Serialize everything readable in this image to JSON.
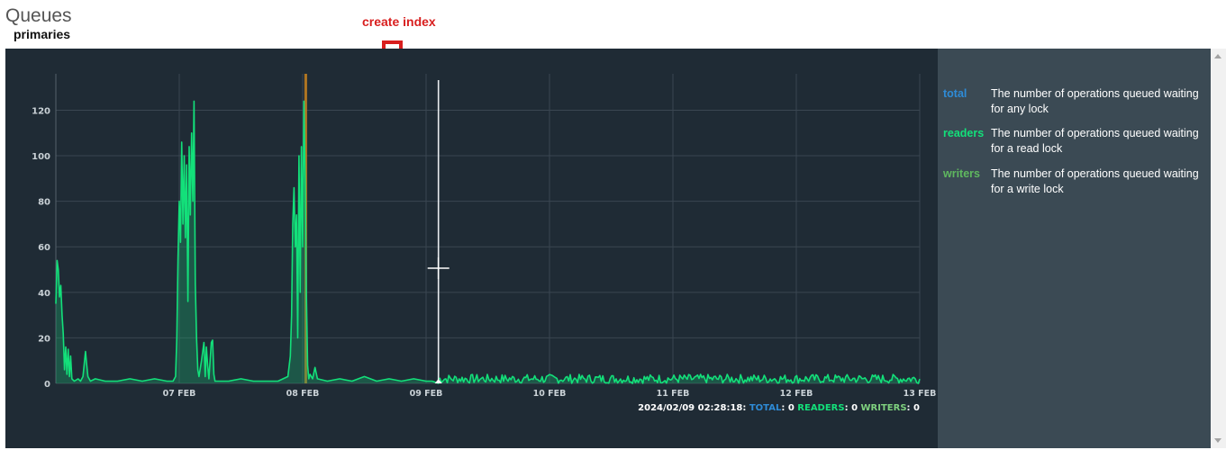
{
  "page": {
    "title": "Queues",
    "subtitle": "primaries",
    "annotation": "create index"
  },
  "legend": [
    {
      "key": "total",
      "color": "#2e8bd6",
      "description": "The number of operations queued waiting for any lock"
    },
    {
      "key": "readers",
      "color": "#13e07a",
      "description": "The number of operations queued waiting for a read lock"
    },
    {
      "key": "writers",
      "color": "#5fb85f",
      "description": "The number of operations queued waiting for a write lock"
    }
  ],
  "readout": {
    "timestamp": "2024/02/09 02:28:18:",
    "total_label": "TOTAL",
    "total_value": ": 0",
    "readers_label": "READERS",
    "readers_value": ": 0",
    "writers_label": "WRITERS",
    "writers_value": ": 0"
  },
  "colors": {
    "panel_bg": "#1f2b35",
    "legend_bg": "#3b4a54",
    "annotation": "#d81e1e",
    "readers": "#13e07a",
    "writers_spike": "#c8821f"
  },
  "chart_data": {
    "type": "line",
    "title": "",
    "xlabel": "",
    "ylabel": "",
    "ylim": [
      0,
      136
    ],
    "xlim_days": [
      "2024-02-06 11:00",
      "2024-02-13 10:00"
    ],
    "yticks": [
      0,
      20,
      40,
      60,
      80,
      100,
      120
    ],
    "xticks": [
      {
        "label": "07 FEB",
        "t": 1.0
      },
      {
        "label": "08 FEB",
        "t": 2.0
      },
      {
        "label": "09 FEB",
        "t": 3.0
      },
      {
        "label": "10 FEB",
        "t": 4.0
      },
      {
        "label": "11 FEB",
        "t": 5.0
      },
      {
        "label": "12 FEB",
        "t": 6.0
      },
      {
        "label": "13 FEB",
        "t": 7.0
      }
    ],
    "grid": true,
    "cursor_t": 3.1,
    "series": [
      {
        "name": "readers",
        "color": "#13e07a",
        "points": [
          [
            0.0,
            35
          ],
          [
            0.01,
            54
          ],
          [
            0.02,
            50
          ],
          [
            0.03,
            38
          ],
          [
            0.04,
            43
          ],
          [
            0.05,
            30
          ],
          [
            0.06,
            22
          ],
          [
            0.07,
            6
          ],
          [
            0.08,
            16
          ],
          [
            0.09,
            4
          ],
          [
            0.1,
            15
          ],
          [
            0.11,
            3
          ],
          [
            0.12,
            12
          ],
          [
            0.13,
            2
          ],
          [
            0.15,
            1
          ],
          [
            0.18,
            2
          ],
          [
            0.2,
            1
          ],
          [
            0.22,
            3
          ],
          [
            0.24,
            14
          ],
          [
            0.25,
            8
          ],
          [
            0.26,
            3
          ],
          [
            0.28,
            1
          ],
          [
            0.32,
            2
          ],
          [
            0.4,
            1
          ],
          [
            0.5,
            1
          ],
          [
            0.6,
            2
          ],
          [
            0.7,
            1
          ],
          [
            0.8,
            2
          ],
          [
            0.9,
            1
          ],
          [
            0.95,
            1
          ],
          [
            0.97,
            3
          ],
          [
            0.98,
            20
          ],
          [
            0.99,
            55
          ],
          [
            1.0,
            80
          ],
          [
            1.01,
            62
          ],
          [
            1.02,
            106
          ],
          [
            1.03,
            70
          ],
          [
            1.04,
            100
          ],
          [
            1.05,
            64
          ],
          [
            1.06,
            96
          ],
          [
            1.07,
            36
          ],
          [
            1.08,
            104
          ],
          [
            1.09,
            74
          ],
          [
            1.1,
            110
          ],
          [
            1.11,
            80
          ],
          [
            1.12,
            124
          ],
          [
            1.13,
            44
          ],
          [
            1.14,
            20
          ],
          [
            1.15,
            6
          ],
          [
            1.16,
            3
          ],
          [
            1.18,
            10
          ],
          [
            1.2,
            18
          ],
          [
            1.21,
            3
          ],
          [
            1.22,
            16
          ],
          [
            1.23,
            8
          ],
          [
            1.24,
            2
          ],
          [
            1.26,
            18
          ],
          [
            1.27,
            19
          ],
          [
            1.28,
            4
          ],
          [
            1.29,
            1
          ],
          [
            1.4,
            1
          ],
          [
            1.5,
            2
          ],
          [
            1.6,
            1
          ],
          [
            1.7,
            1
          ],
          [
            1.8,
            1
          ],
          [
            1.88,
            3
          ],
          [
            1.9,
            12
          ],
          [
            1.91,
            30
          ],
          [
            1.92,
            70
          ],
          [
            1.93,
            86
          ],
          [
            1.94,
            60
          ],
          [
            1.95,
            74
          ],
          [
            1.96,
            20
          ],
          [
            1.97,
            100
          ],
          [
            1.98,
            40
          ],
          [
            1.99,
            104
          ],
          [
            2.0,
            60
          ],
          [
            2.01,
            124
          ],
          [
            2.02,
            90
          ],
          [
            2.03,
            40
          ],
          [
            2.04,
            8
          ],
          [
            2.05,
            2
          ],
          [
            2.06,
            4
          ],
          [
            2.08,
            2
          ],
          [
            2.1,
            7
          ],
          [
            2.12,
            2
          ],
          [
            2.2,
            1
          ],
          [
            2.3,
            2
          ],
          [
            2.4,
            1
          ],
          [
            2.5,
            3
          ],
          [
            2.6,
            1
          ],
          [
            2.7,
            2
          ],
          [
            2.8,
            1
          ],
          [
            2.9,
            2
          ],
          [
            3.0,
            1
          ],
          [
            3.05,
            1
          ],
          [
            3.1,
            0
          ]
        ]
      }
    ],
    "noise_floor": {
      "from_t": 3.1,
      "to_t": 7.0,
      "min": 0,
      "max": 4
    }
  }
}
